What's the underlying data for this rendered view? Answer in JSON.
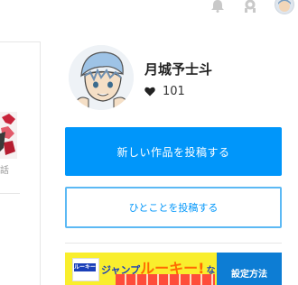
{
  "header": {
    "icons": [
      "bell-icon",
      "gear-icon",
      "user-avatar"
    ]
  },
  "left": {
    "thumb_caption": "話"
  },
  "profile": {
    "username": "月城予士斗",
    "like_count": "101"
  },
  "actions": {
    "post_work_label": "新しい作品を投稿する",
    "post_note_label": "ひとことを投稿する"
  },
  "banner": {
    "line_a": "ジャンプ",
    "line_b": "ルーキー!",
    "line_c": "なら",
    "side_label": "設定方法",
    "logo_text": "ルーキー"
  },
  "colors": {
    "accent": "#0096fa",
    "secondary_border": "#5cb9f4",
    "divider": "#e6e6e6",
    "banner_yellow": "#f9ee2d"
  }
}
